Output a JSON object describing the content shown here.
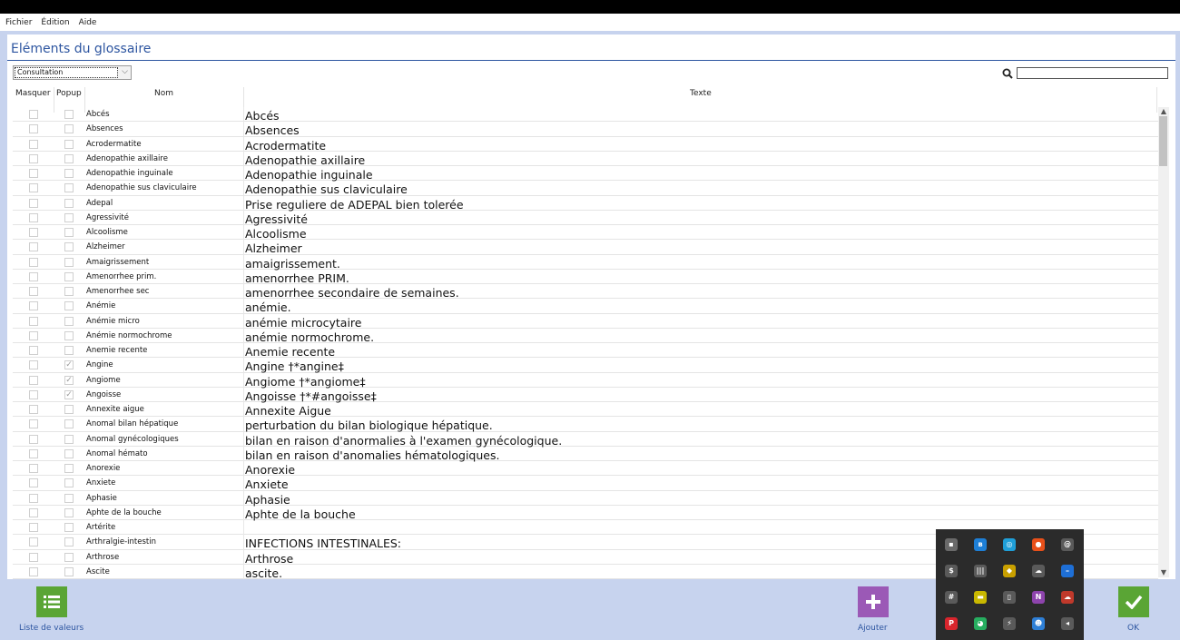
{
  "menu": {
    "items": [
      "Fichier",
      "Édition",
      "Aide"
    ]
  },
  "panel": {
    "title": "Eléments du glossaire"
  },
  "mode_select": {
    "value": "Consultation"
  },
  "search": {
    "placeholder": ""
  },
  "table": {
    "headers": {
      "masquer": "Masquer",
      "popup": "Popup",
      "nom": "Nom",
      "texte": "Texte"
    },
    "rows": [
      {
        "masquer": false,
        "popup": false,
        "nom": "Abcés",
        "texte": "Abcés"
      },
      {
        "masquer": false,
        "popup": false,
        "nom": "Absences",
        "texte": "Absences"
      },
      {
        "masquer": false,
        "popup": false,
        "nom": "Acrodermatite",
        "texte": "Acrodermatite"
      },
      {
        "masquer": false,
        "popup": false,
        "nom": "Adenopathie axillaire",
        "texte": "Adenopathie axillaire"
      },
      {
        "masquer": false,
        "popup": false,
        "nom": "Adenopathie inguinale",
        "texte": "Adenopathie inguinale"
      },
      {
        "masquer": false,
        "popup": false,
        "nom": "Adenopathie sus claviculaire",
        "texte": "Adenopathie sus claviculaire"
      },
      {
        "masquer": false,
        "popup": false,
        "nom": "Adepal",
        "texte": "Prise reguliere de ADEPAL bien tolerée"
      },
      {
        "masquer": false,
        "popup": false,
        "nom": "Agressivité",
        "texte": "Agressivité"
      },
      {
        "masquer": false,
        "popup": false,
        "nom": "Alcoolisme",
        "texte": "Alcoolisme"
      },
      {
        "masquer": false,
        "popup": false,
        "nom": "Alzheimer",
        "texte": "Alzheimer"
      },
      {
        "masquer": false,
        "popup": false,
        "nom": "Amaigrissement",
        "texte": "amaigrissement."
      },
      {
        "masquer": false,
        "popup": false,
        "nom": "Amenorrhee prim.",
        "texte": "amenorrhee PRIM."
      },
      {
        "masquer": false,
        "popup": false,
        "nom": "Amenorrhee sec",
        "texte": "amenorrhee secondaire de      semaines."
      },
      {
        "masquer": false,
        "popup": false,
        "nom": "Anémie",
        "texte": "anémie."
      },
      {
        "masquer": false,
        "popup": false,
        "nom": "Anémie micro",
        "texte": "anémie microcytaire"
      },
      {
        "masquer": false,
        "popup": false,
        "nom": "Anémie normochrome",
        "texte": "anémie normochrome."
      },
      {
        "masquer": false,
        "popup": false,
        "nom": "Anemie recente",
        "texte": "Anemie recente"
      },
      {
        "masquer": false,
        "popup": true,
        "nom": "Angine",
        "texte": "Angine †*angine‡"
      },
      {
        "masquer": false,
        "popup": true,
        "nom": "Angiome",
        "texte": "Angiome †*angiome‡"
      },
      {
        "masquer": false,
        "popup": true,
        "nom": "Angoisse",
        "texte": "Angoisse †*#angoisse‡"
      },
      {
        "masquer": false,
        "popup": false,
        "nom": "Annexite aigue",
        "texte": "Annexite Aigue"
      },
      {
        "masquer": false,
        "popup": false,
        "nom": "Anomal bilan hépatique",
        "texte": "perturbation du bilan biologique hépatique."
      },
      {
        "masquer": false,
        "popup": false,
        "nom": "Anomal gynécologiques",
        "texte": "bilan en raison d'anormalies à l'examen gynécologique."
      },
      {
        "masquer": false,
        "popup": false,
        "nom": "Anomal hémato",
        "texte": "bilan en raison d'anomalies hématologiques."
      },
      {
        "masquer": false,
        "popup": false,
        "nom": "Anorexie",
        "texte": "Anorexie"
      },
      {
        "masquer": false,
        "popup": false,
        "nom": "Anxiete",
        "texte": "Anxiete"
      },
      {
        "masquer": false,
        "popup": false,
        "nom": "Aphasie",
        "texte": "Aphasie"
      },
      {
        "masquer": false,
        "popup": false,
        "nom": "Aphte de la bouche",
        "texte": "Aphte de la bouche"
      },
      {
        "masquer": false,
        "popup": false,
        "nom": "Artérite",
        "texte": ""
      },
      {
        "masquer": false,
        "popup": false,
        "nom": "Arthralgie-intestin",
        "texte": "INFECTIONS INTESTINALES:"
      },
      {
        "masquer": false,
        "popup": false,
        "nom": "Arthrose",
        "texte": "Arthrose"
      },
      {
        "masquer": false,
        "popup": false,
        "nom": "Ascite",
        "texte": "ascite."
      }
    ]
  },
  "buttons": {
    "liste": {
      "label": "Liste de valeurs",
      "color": "#5aa535",
      "icon": "list-icon"
    },
    "ajouter": {
      "label": "Ajouter",
      "color": "#9b59b6",
      "icon": "plus-icon"
    },
    "ok": {
      "label": "OK",
      "color": "#5aa535",
      "icon": "checkmark-icon"
    }
  },
  "colors": {
    "accent": "#2d55a0",
    "background": "#c7d3ee",
    "tray": "#2b2b2b"
  },
  "tray": {
    "icons": [
      {
        "name": "network-icon",
        "glyph": "▪",
        "color": "#6a6a6a"
      },
      {
        "name": "bluetooth-icon",
        "glyph": "ʙ",
        "color": "#1e7fd6"
      },
      {
        "name": "sync-icon",
        "glyph": "◎",
        "color": "#1f9fd8"
      },
      {
        "name": "firefox-icon",
        "glyph": "●",
        "color": "#e8501a"
      },
      {
        "name": "spiral-icon",
        "glyph": "@",
        "color": "#5a5a5a"
      },
      {
        "name": "dollar-icon",
        "glyph": "$",
        "color": "#5a5a5a"
      },
      {
        "name": "audio-bars-icon",
        "glyph": "|||",
        "color": "#5a5a5a"
      },
      {
        "name": "shield-icon",
        "glyph": "◆",
        "color": "#c9a000"
      },
      {
        "name": "cloud-off-icon",
        "glyph": "☁",
        "color": "#5a5a5a"
      },
      {
        "name": "minus-circle-icon",
        "glyph": "–",
        "color": "#1e6fd6"
      },
      {
        "name": "hash-icon",
        "glyph": "#",
        "color": "#5a5a5a"
      },
      {
        "name": "card-icon",
        "glyph": "▬",
        "color": "#c9b800"
      },
      {
        "name": "usb-icon",
        "glyph": "▯",
        "color": "#5a5a5a"
      },
      {
        "name": "nvidia-icon",
        "glyph": "N",
        "color": "#8e44ad"
      },
      {
        "name": "cloud-red-icon",
        "glyph": "☁",
        "color": "#c0392b"
      },
      {
        "name": "app-red-icon",
        "glyph": "P",
        "color": "#d9252d"
      },
      {
        "name": "pie-green-icon",
        "glyph": "◕",
        "color": "#27ae60"
      },
      {
        "name": "plug-icon",
        "glyph": "⚡",
        "color": "#5a5a5a"
      },
      {
        "name": "user-globe-icon",
        "glyph": "☻",
        "color": "#2e7fd6"
      },
      {
        "name": "speaker-icon",
        "glyph": "◂",
        "color": "#5a5a5a"
      }
    ]
  }
}
